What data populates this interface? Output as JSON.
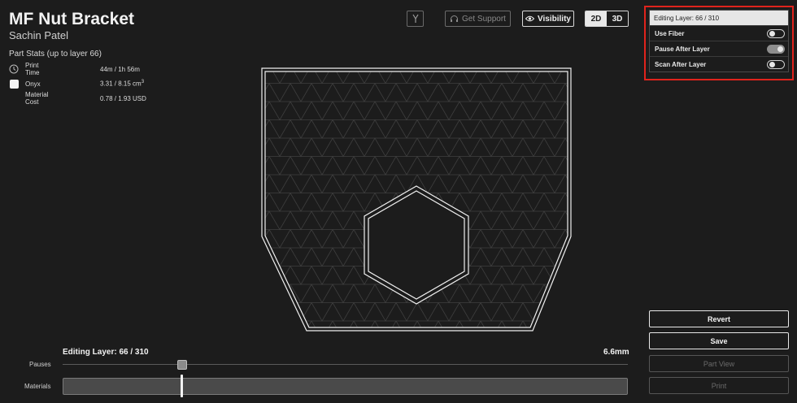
{
  "part": {
    "title": "MF Nut Bracket",
    "owner": "Sachin Patel"
  },
  "stats": {
    "heading": "Part Stats (up to layer 66)",
    "rows": [
      {
        "icon": "clock-icon",
        "label": "Print Time",
        "value": "44m / 1h 56m"
      },
      {
        "icon": "material-swatch",
        "label": "Onyx",
        "value": "3.31 / 8.15 cm",
        "unit_sup": "3"
      },
      {
        "icon": "",
        "label": "Material Cost",
        "value": "0.78 / 1.93 USD"
      }
    ]
  },
  "toolbar": {
    "branch_icon": "fork-icon",
    "support_label": "Get Support",
    "support_icon": "headset-icon",
    "visibility_label": "Visibility",
    "visibility_icon": "eye-icon",
    "view_2d": "2D",
    "view_3d": "3D",
    "active_view": "2D"
  },
  "layer_panel": {
    "header": "Editing Layer: 66 / 310",
    "toggles": [
      {
        "label": "Use Fiber",
        "on": false
      },
      {
        "label": "Pause After Layer",
        "on": true
      },
      {
        "label": "Scan After Layer",
        "on": false
      }
    ],
    "highlight_color": "#e0231c"
  },
  "slider": {
    "editing_label": "Editing Layer: 66 / 310",
    "height_label": "6.6mm",
    "pauses_label": "Pauses",
    "materials_label": "Materials",
    "current_layer": 66,
    "total_layers": 310
  },
  "actions": {
    "revert": "Revert",
    "save": "Save",
    "part_view": "Part View",
    "print": "Print"
  }
}
